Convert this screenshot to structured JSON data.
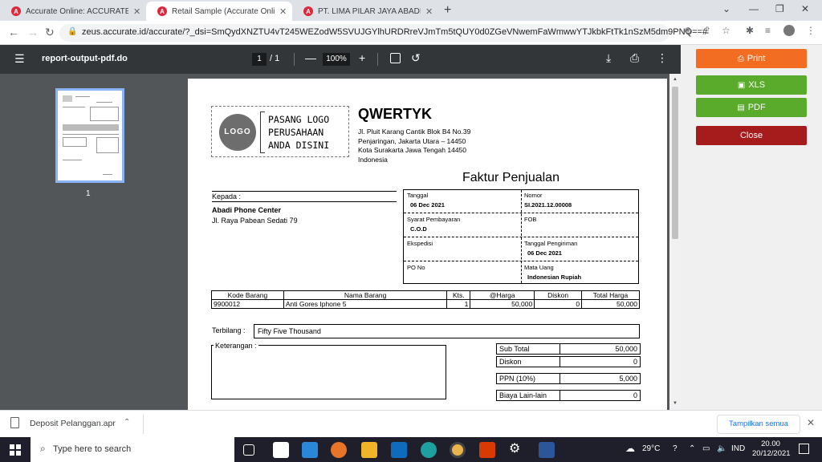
{
  "browser": {
    "tabs": [
      {
        "title": "Accurate Online: ACCURATE Data",
        "active": false
      },
      {
        "title": "Retail Sample (Accurate Online)",
        "active": true
      },
      {
        "title": "PT. LIMA PILAR JAYA ABADI (Acc",
        "active": false
      }
    ],
    "url": "zeus.accurate.id/accurate/?_dsi=SmQydXNZTU4vT245WEZodW5SVUJGYlhURDRreVJmTm5tQUY0d0ZGeVNwemFaWmwwYTJkbkFtTk1nSzM5dm9PNQ==#"
  },
  "pdf_viewer": {
    "filename": "report-output-pdf.do",
    "current_page": "1",
    "page_total": "/  1",
    "zoom": "100%",
    "thumbnail_label": "1"
  },
  "invoice": {
    "logo_circle": "LOGO",
    "logo_line1": "PASANG LOGO",
    "logo_line2": "PERUSAHAAN",
    "logo_line3": "ANDA DISINI",
    "company_name": "QWERTYK",
    "address_line1": "Jl. Pluit Karang Cantik Blok B4 No.39",
    "address_line2": "Penjaringan, Jakarta Utara – 14450",
    "address_line3": "Kota Surakarta Jawa Tengah 14450",
    "address_line4": "Indonesia",
    "title": "Faktur Penjualan",
    "to_label": "Kepada :",
    "customer_name": "Abadi Phone Center",
    "customer_address": "Jl. Raya Pabean Sedati 79",
    "info": {
      "date_label": "Tanggal",
      "date_value": "06 Dec 2021",
      "number_label": "Nomor",
      "number_value": "SI.2021.12.00008",
      "payment_terms_label": "Syarat Pembayaran",
      "payment_terms_value": "C.O.D",
      "fob_label": "FOB",
      "fob_value": "",
      "expedition_label": "Ekspedisi",
      "expedition_value": "",
      "ship_date_label": "Tanggal Pengiriman",
      "ship_date_value": "06 Dec 2021",
      "po_label": "PO No",
      "po_value": "",
      "currency_label": "Mata Uang",
      "currency_value": "Indonesian Rupiah"
    },
    "items_headers": [
      "Kode Barang",
      "Nama Barang",
      "Kts.",
      "@Harga",
      "Diskon",
      "Total Harga"
    ],
    "items": [
      {
        "code": "9900012",
        "name": "Anti Gores Iphone 5",
        "qty": "1",
        "price": "50,000",
        "discount": "0",
        "total": "50,000"
      }
    ],
    "amount_words_label": "Terbilang :",
    "amount_words_value": "Fifty Five Thousand",
    "notes_label": "Keterangan :",
    "subtotal_label": "Sub Total",
    "subtotal_value": "50,000",
    "discount_label": "Diskon",
    "discount_value": "0",
    "vat_label": "PPN (10%)",
    "vat_value": "5,000",
    "other_cost_label": "Biaya Lain-lain",
    "other_cost_value": "0"
  },
  "actions": {
    "print_label": "Print",
    "xls_label": "XLS",
    "pdf_label": "PDF",
    "close_label": "Close",
    "colors": {
      "print": "#f26d21",
      "xls": "#5aaa2c",
      "pdf": "#5aaa2c",
      "close": "#a61b1b"
    }
  },
  "downloads": {
    "file_name": "Deposit Pelanggan.apr",
    "show_all_label": "Tampilkan semua"
  },
  "taskbar": {
    "search_placeholder": "Type here to search",
    "weather": "29°C",
    "language": "IND",
    "time": "20.00",
    "date": "20/12/2021"
  }
}
